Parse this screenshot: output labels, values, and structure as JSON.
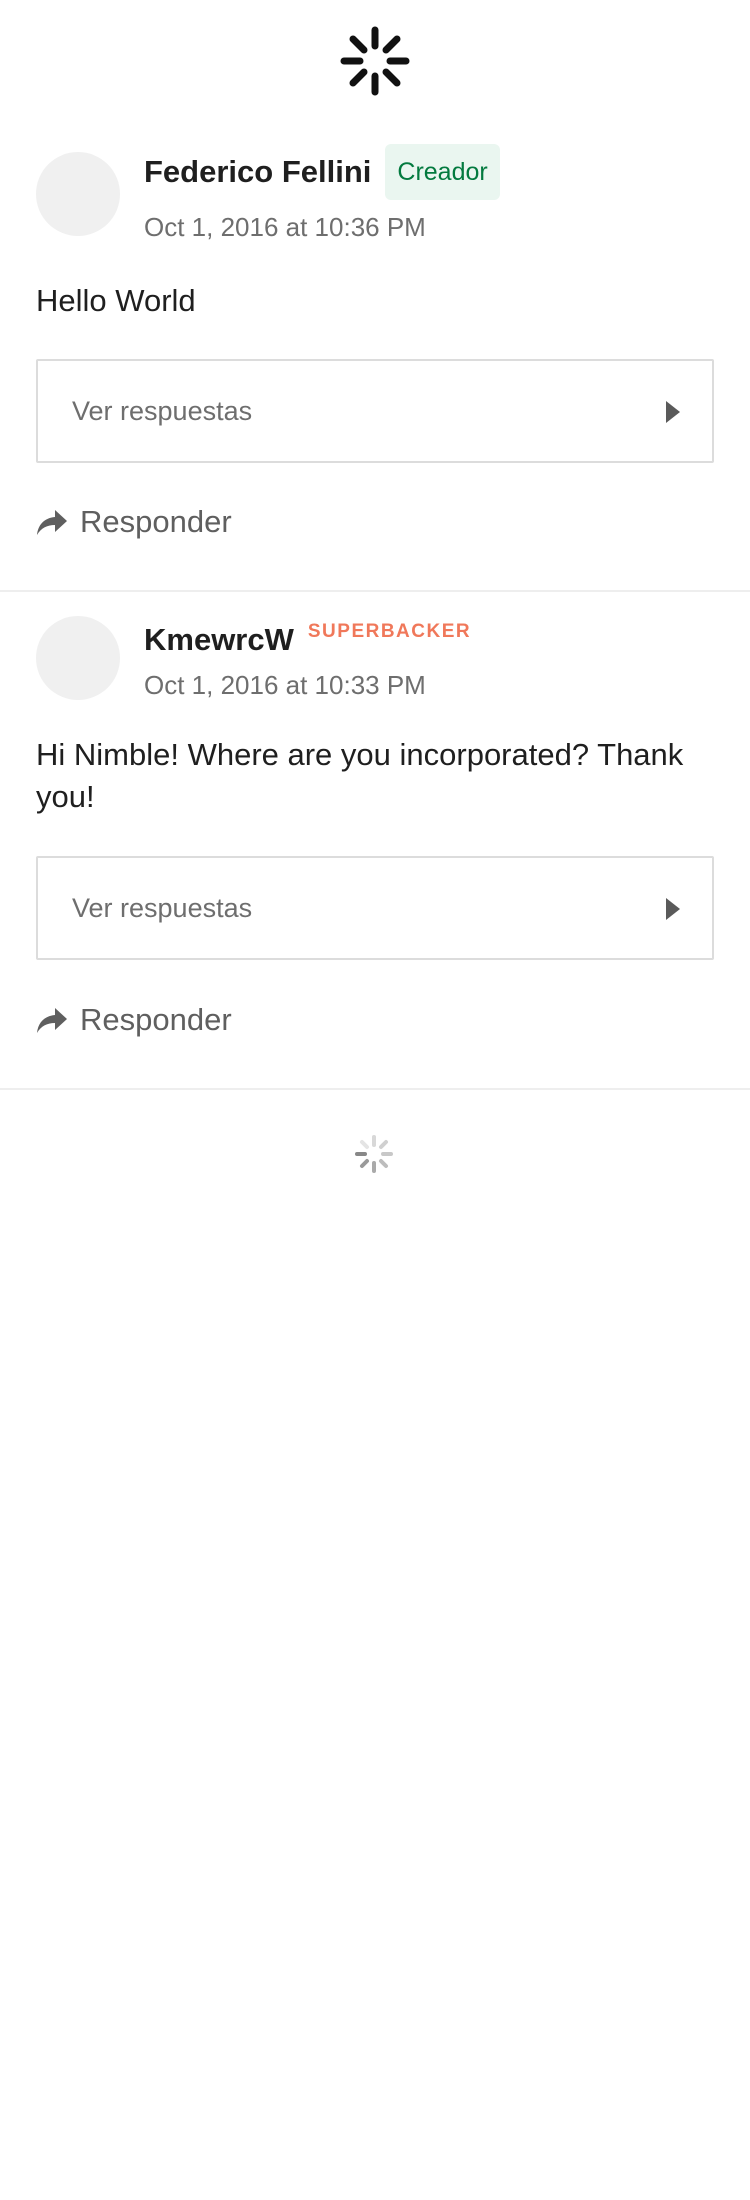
{
  "comments": [
    {
      "author": "Federico Fellini",
      "badge": "Creador",
      "timestamp": "Oct 1, 2016 at 10:36 PM",
      "body": "Hello World",
      "replies_label": "Ver respuestas",
      "reply_label": "Responder"
    },
    {
      "author": "KmewrcW",
      "badge": "SUPERBACKER",
      "timestamp": "Oct 1, 2016 at 10:33 PM",
      "body": "Hi Nimble! Where are you incorporated? Thank you!",
      "replies_label": "Ver respuestas",
      "reply_label": "Responder"
    }
  ],
  "icons": {
    "top": "loading-spinner-icon",
    "bottom": "loading-spinner-icon",
    "replies": "chevron-right-icon",
    "reply": "reply-arrow-icon"
  },
  "colors": {
    "creator_badge_bg": "#eaf6f0",
    "creator_badge_text": "#037a3f",
    "superbacker_text": "#f0785a",
    "divider": "#eeeeee"
  }
}
